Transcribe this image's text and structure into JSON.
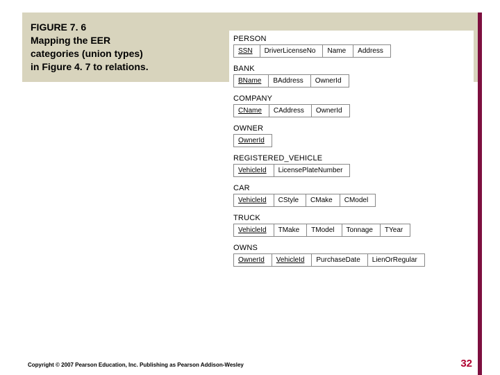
{
  "caption": {
    "line1": "FIGURE 7. 6",
    "line2": "Mapping the EER",
    "line3": "categories (union types)",
    "line4": "in Figure 4. 7 to relations."
  },
  "relations": [
    {
      "name": "PERSON",
      "attrs": [
        {
          "label": "SSN",
          "key": true
        },
        {
          "label": "DriverLicenseNo",
          "key": false
        },
        {
          "label": "Name",
          "key": false
        },
        {
          "label": "Address",
          "key": false
        }
      ]
    },
    {
      "name": "BANK",
      "attrs": [
        {
          "label": "BName",
          "key": true
        },
        {
          "label": "BAddress",
          "key": false
        },
        {
          "label": "OwnerId",
          "key": false
        }
      ]
    },
    {
      "name": "COMPANY",
      "attrs": [
        {
          "label": "CName",
          "key": true
        },
        {
          "label": "CAddress",
          "key": false
        },
        {
          "label": "OwnerId",
          "key": false
        }
      ]
    },
    {
      "name": "OWNER",
      "attrs": [
        {
          "label": "OwnerId",
          "key": true
        }
      ]
    },
    {
      "name": "REGISTERED_VEHICLE",
      "attrs": [
        {
          "label": "VehicleId",
          "key": true
        },
        {
          "label": "LicensePlateNumber",
          "key": false
        }
      ]
    },
    {
      "name": "CAR",
      "attrs": [
        {
          "label": "VehicleId",
          "key": true
        },
        {
          "label": "CStyle",
          "key": false
        },
        {
          "label": "CMake",
          "key": false
        },
        {
          "label": "CModel",
          "key": false
        }
      ]
    },
    {
      "name": "TRUCK",
      "attrs": [
        {
          "label": "VehicleId",
          "key": true
        },
        {
          "label": "TMake",
          "key": false
        },
        {
          "label": "TModel",
          "key": false
        },
        {
          "label": "Tonnage",
          "key": false
        },
        {
          "label": "TYear",
          "key": false
        }
      ]
    },
    {
      "name": "OWNS",
      "attrs": [
        {
          "label": "OwnerId",
          "key": true
        },
        {
          "label": "VehicleId",
          "key": true
        },
        {
          "label": "PurchaseDate",
          "key": false
        },
        {
          "label": "LienOrRegular",
          "key": false
        }
      ]
    }
  ],
  "footer": "Copyright © 2007 Pearson Education, Inc. Publishing as Pearson Addison-Wesley",
  "page": "32"
}
